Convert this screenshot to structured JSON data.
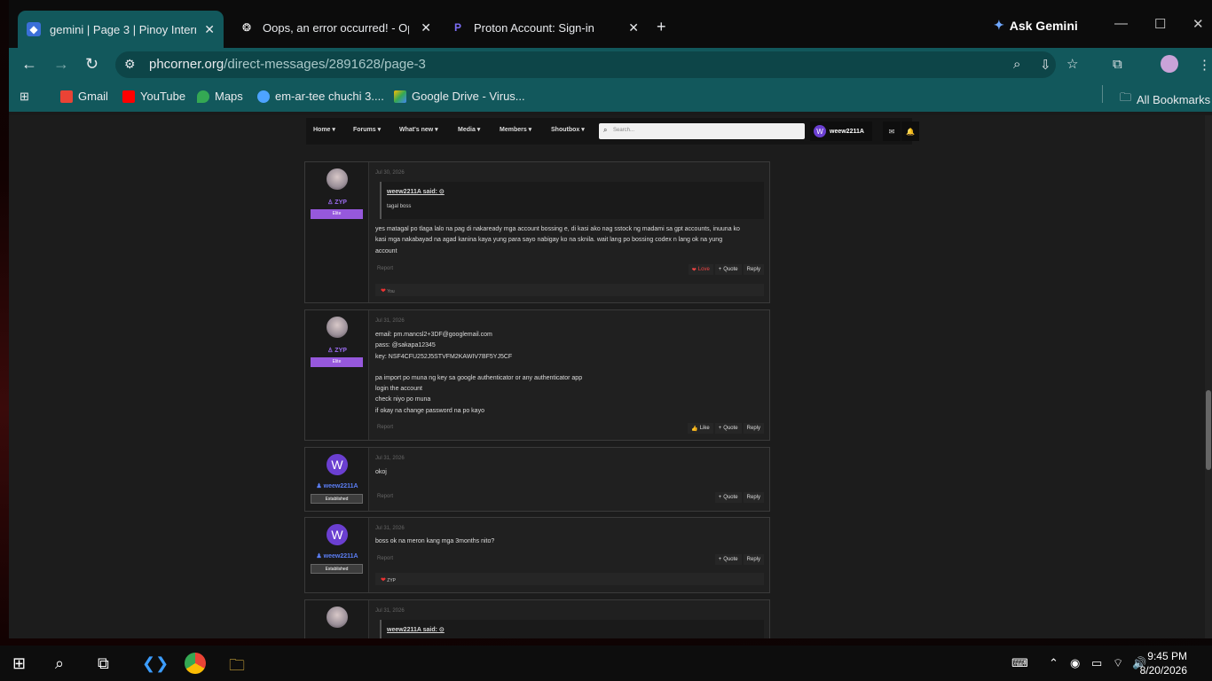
{
  "tabs": [
    {
      "title": "gemini | Page 3 | Pinoy Internet",
      "icon": "phcorner-icon",
      "active": true
    },
    {
      "title": "Oops, an error occurred! - Oper",
      "icon": "openai-icon",
      "active": false
    },
    {
      "title": "Proton Account: Sign-in",
      "icon": "proton-icon",
      "active": false
    }
  ],
  "ask_gemini": "Ask Gemini",
  "address": {
    "host": "phcorner.org",
    "path": "/direct-messages/2891628/page-3"
  },
  "bookmarks": [
    {
      "label": "Gmail",
      "color": "#ea4335"
    },
    {
      "label": "YouTube",
      "color": "#ff0000"
    },
    {
      "label": "Maps",
      "color": "#34a853"
    },
    {
      "label": "em-ar-tee chuchi 3....",
      "color": "#4da3ff"
    },
    {
      "label": "Google Drive - Virus...",
      "color": "#fbbc04"
    }
  ],
  "all_bookmarks": "All Bookmarks",
  "site_nav": {
    "items": [
      "Home",
      "Forums",
      "What's new",
      "Media",
      "Members",
      "Shoutbox"
    ],
    "search_placeholder": "Search...",
    "user": "weew2211A",
    "user_initial": "W"
  },
  "posts": [
    {
      "user": "ZYP",
      "rank": "Elite",
      "date": "Jul 30, 2026",
      "quote_author": "weew2211A said:",
      "quote_text": "tagal boss",
      "lines": [
        "yes matagal po tlaga lalo na pag di nakaready mga account bossing e, di kasi ako nag sstock ng madami sa gpt accounts, inuuna ko",
        "kasi mga nakabayad na agad kanina kaya yung para sayo nabigay ko na sknila. wait lang po bossing codex n lang ok na yung",
        "account"
      ],
      "report": "Report",
      "buttons": [
        "Love",
        "Quote",
        "Reply"
      ],
      "reaction": "You"
    },
    {
      "user": "ZYP",
      "rank": "Elite",
      "date": "Jul 31, 2026",
      "lines": [
        "email: pm.mancsl2+3DF@googlemail.com",
        "pass: @sakapa12345",
        "key: NSF4CFU252J5STVFM2KAWIV7BF5YJ5CF",
        "",
        "pa import po muna ng key sa google authenticator or any authenticator app",
        "login the account",
        "check niyo po muna",
        "if okay na change password na po kayo"
      ],
      "report": "Report",
      "buttons": [
        "Like",
        "Quote",
        "Reply"
      ]
    },
    {
      "user": "weew2211A",
      "initial": "W",
      "rank": "Established",
      "date": "Jul 31, 2026",
      "lines": [
        "okoj"
      ],
      "report": "Report",
      "buttons": [
        "Quote",
        "Reply"
      ]
    },
    {
      "user": "weew2211A",
      "initial": "W",
      "rank": "Established",
      "date": "Jul 31, 2026",
      "lines": [
        "boss ok na meron kang mga 3months nito?"
      ],
      "report": "Report",
      "buttons": [
        "Quote",
        "Reply"
      ],
      "reaction": "ZYP"
    },
    {
      "user": "ZYP",
      "rank": "Elite",
      "date": "Jul 31, 2026",
      "quote_author": "weew2211A said:"
    }
  ],
  "clock": {
    "time": "9:45 PM",
    "date": "8/20/2026"
  }
}
